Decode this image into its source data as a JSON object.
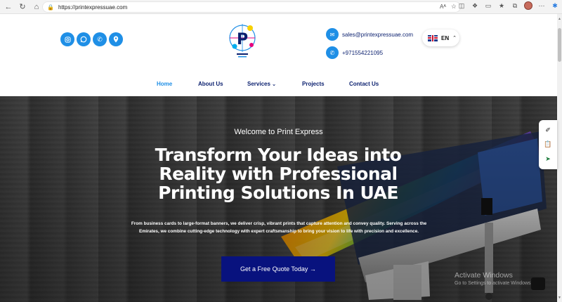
{
  "browser": {
    "url": "https://printexpressuae.com",
    "reader_label": "Aᴬ"
  },
  "header": {
    "social_icons": [
      "instagram-icon",
      "whatsapp-icon",
      "phone-icon",
      "location-icon"
    ],
    "contact": {
      "email": "sales@printexpressuae.com",
      "phone": "+971554221095"
    },
    "language": {
      "code": "EN"
    }
  },
  "menu": {
    "items": [
      "Home",
      "About Us",
      "Services",
      "Projects",
      "Contact Us"
    ],
    "active": "Home"
  },
  "hero": {
    "welcome": "Welcome to Print Express",
    "headline": "Transform Your Ideas into Reality with Professional Printing Solutions In UAE",
    "body": "From business cards to large-format banners, we deliver crisp, vibrant prints that capture attention and convey quality. Serving across the Emirates, we combine cutting-edge technology with expert craftsmanship to bring your vision to life with precision and excellence.",
    "cta": "Get a Free Quote Today →"
  },
  "watermark": {
    "line1": "Activate Windows",
    "line2": "Go to Settings to activate Windows."
  },
  "colors": {
    "brand_blue": "#1f8fe6",
    "navy": "#0a1f6e",
    "cta_bg": "#08127e"
  }
}
